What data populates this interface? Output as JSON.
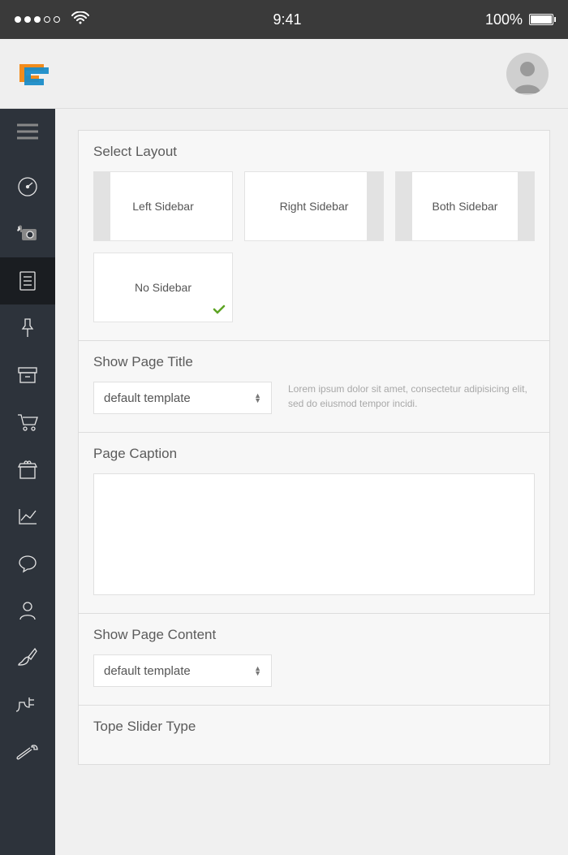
{
  "status": {
    "time": "9:41",
    "battery": "100%"
  },
  "sections": {
    "select_layout": {
      "title": "Select Layout",
      "options": {
        "left": "Left Sidebar",
        "right": "Right Sidebar",
        "both": "Both Sidebar",
        "none": "No Sidebar"
      }
    },
    "show_page_title": {
      "title": "Show Page Title",
      "select_value": "default template",
      "helper": "Lorem ipsum dolor sit amet, consectetur adipisicing elit, sed do eiusmod tempor incidi."
    },
    "page_caption": {
      "title": "Page Caption"
    },
    "show_page_content": {
      "title": "Show Page Content",
      "select_value": "default template"
    },
    "tope_slider": {
      "title": "Tope Slider Type"
    }
  }
}
